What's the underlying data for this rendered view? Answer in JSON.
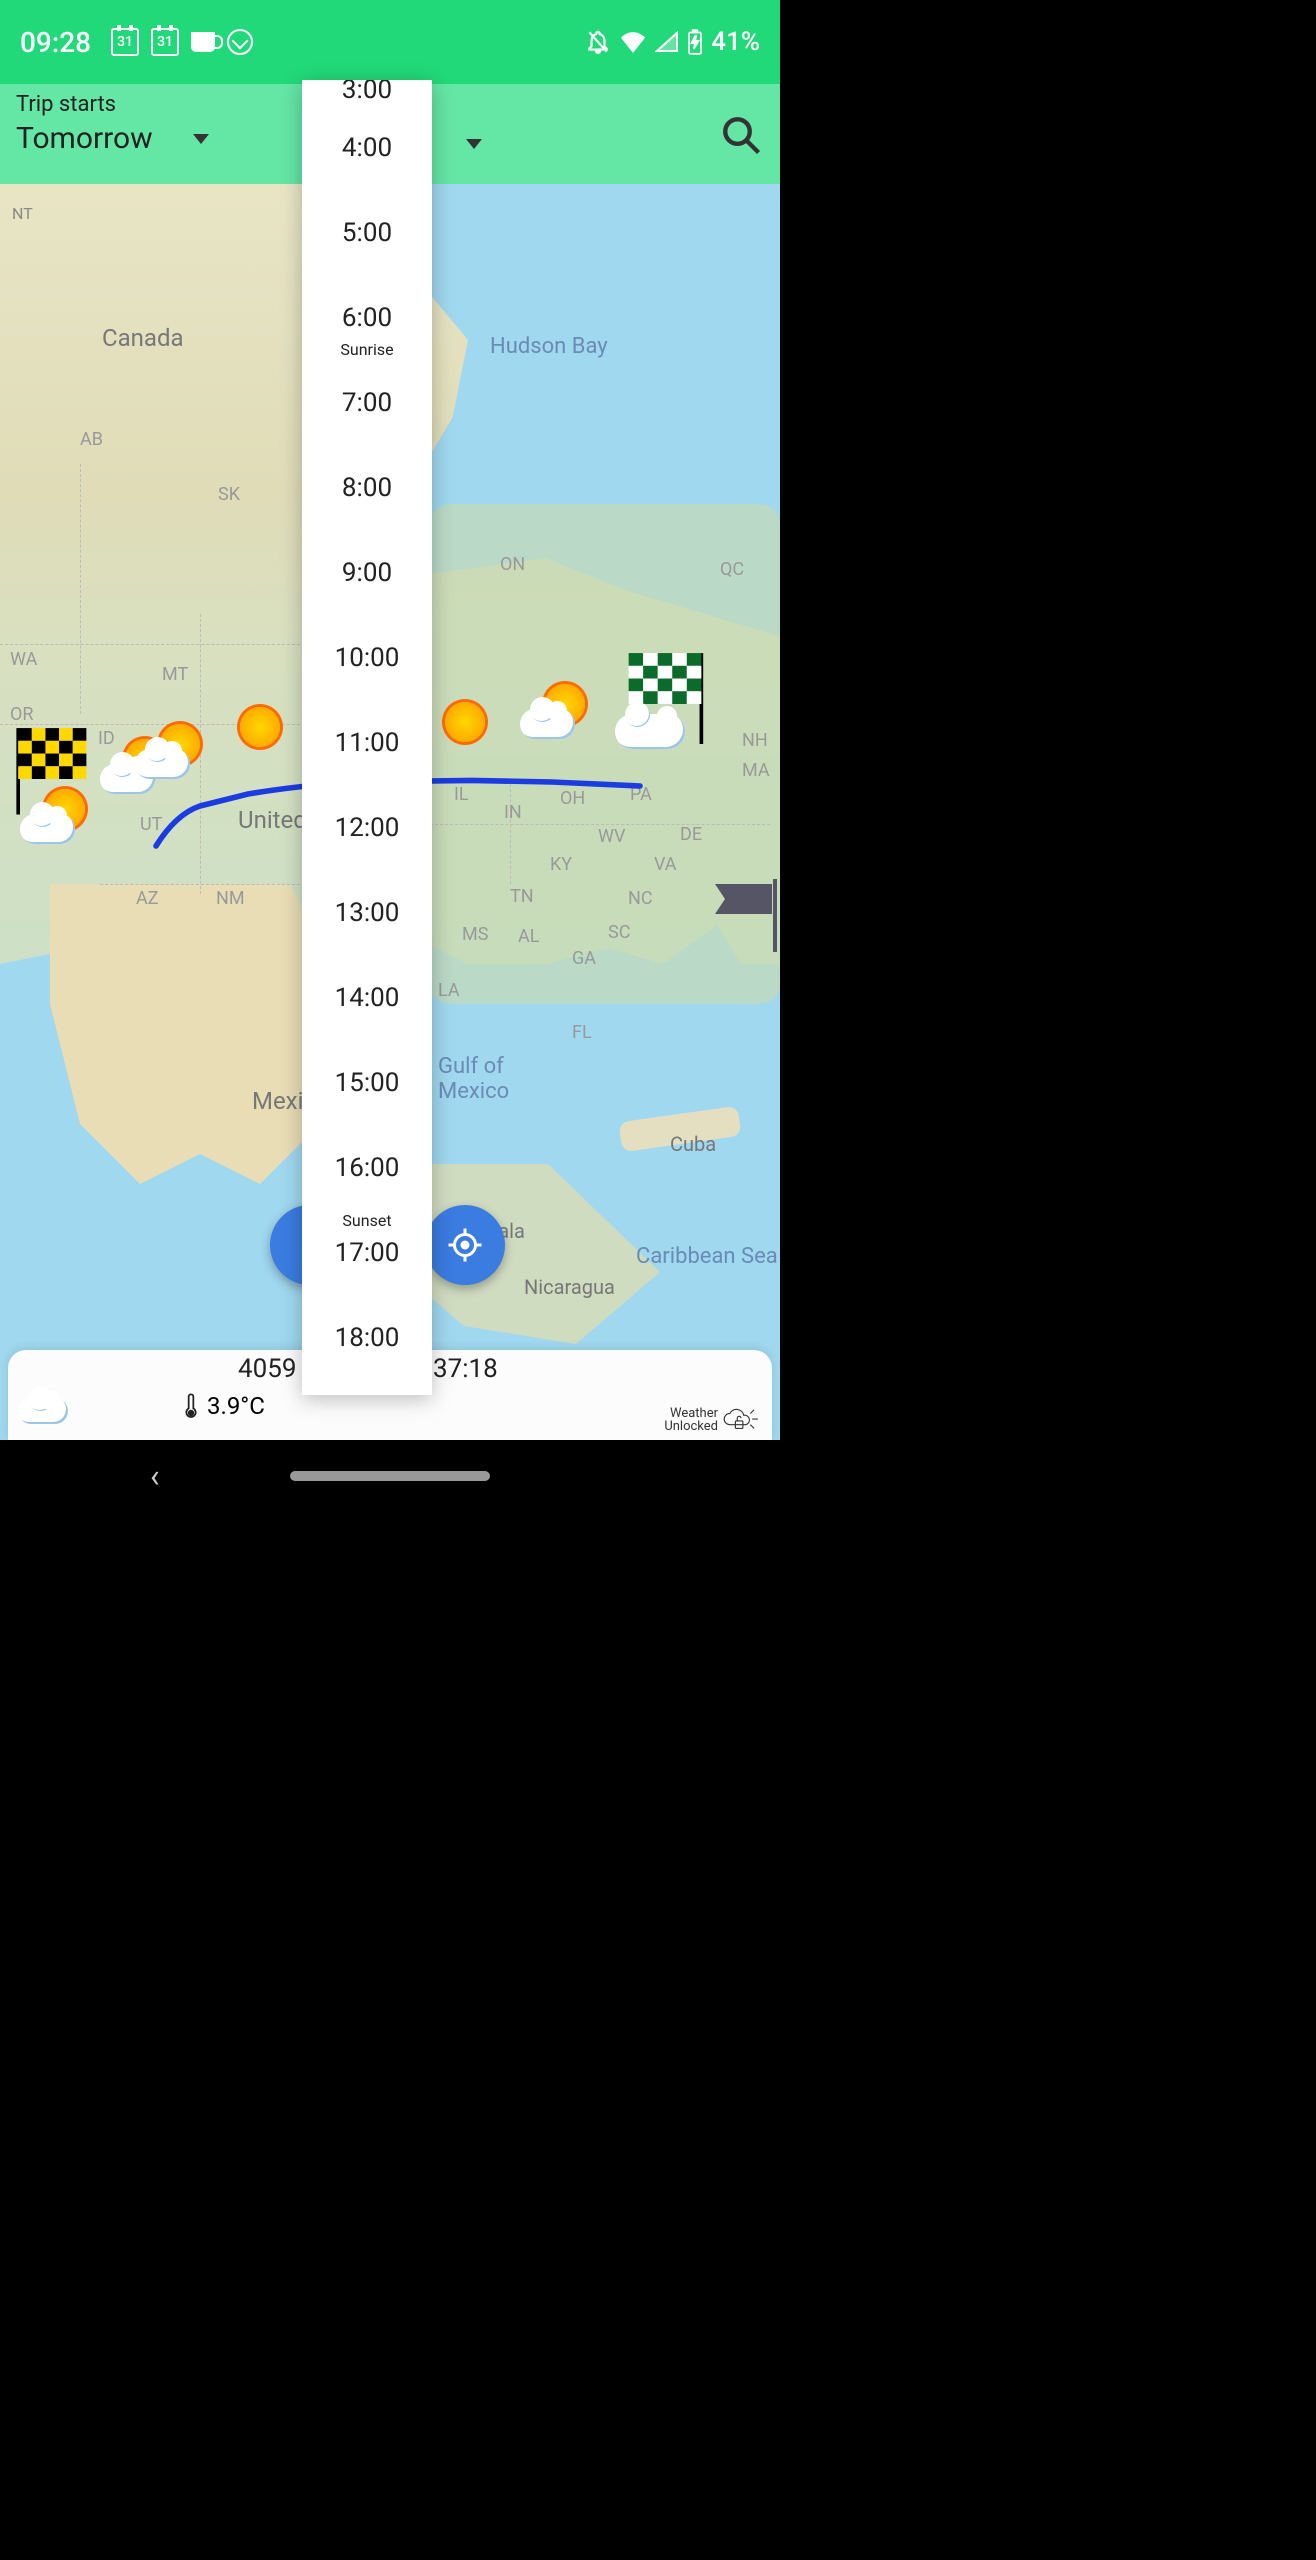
{
  "status": {
    "time": "09:28",
    "calendar_day": "31",
    "battery_text": "41%"
  },
  "header": {
    "trip_label": "Trip starts",
    "day_selected": "Tomorrow"
  },
  "time_picker": {
    "items": [
      {
        "time": "3:00"
      },
      {
        "time": "4:00"
      },
      {
        "time": "5:00"
      },
      {
        "time": "6:00"
      },
      {
        "time": "7:00",
        "sub_above": "Sunrise"
      },
      {
        "time": "8:00"
      },
      {
        "time": "9:00"
      },
      {
        "time": "10:00"
      },
      {
        "time": "11:00"
      },
      {
        "time": "12:00"
      },
      {
        "time": "13:00"
      },
      {
        "time": "14:00"
      },
      {
        "time": "15:00"
      },
      {
        "time": "16:00",
        "sub_below": "Sunset"
      },
      {
        "time": "17:00"
      },
      {
        "time": "18:00"
      }
    ]
  },
  "map": {
    "labels": {
      "nt": "NT",
      "canada": "Canada",
      "hudson": "Hudson Bay",
      "ab": "AB",
      "sk": "SK",
      "on": "ON",
      "qc": "QC",
      "wa": "WA",
      "mt": "MT",
      "or": "OR",
      "id": "ID",
      "ut": "UT",
      "az": "AZ",
      "nm": "NM",
      "nh": "NH",
      "ma": "MA",
      "il": "IL",
      "in": "IN",
      "oh": "OH",
      "pa": "PA",
      "wv": "WV",
      "de": "DE",
      "ky": "KY",
      "va": "VA",
      "tn": "TN",
      "nc": "NC",
      "ms": "MS",
      "al": "AL",
      "sc": "SC",
      "ga": "GA",
      "la": "LA",
      "fl": "FL",
      "united": "United",
      "mexico": "Mexicc",
      "gulf": "Gulf of\nMexico",
      "cuba": "Cuba",
      "guatemala": "Guatemala",
      "nicaragua": "Nicaragua",
      "caribbean": "Caribbean Sea"
    }
  },
  "bottom": {
    "distance": "4059",
    "duration": "37:18",
    "temp": "3.9°C",
    "credit_line1": "Weather",
    "credit_line2": "Unlocked"
  }
}
